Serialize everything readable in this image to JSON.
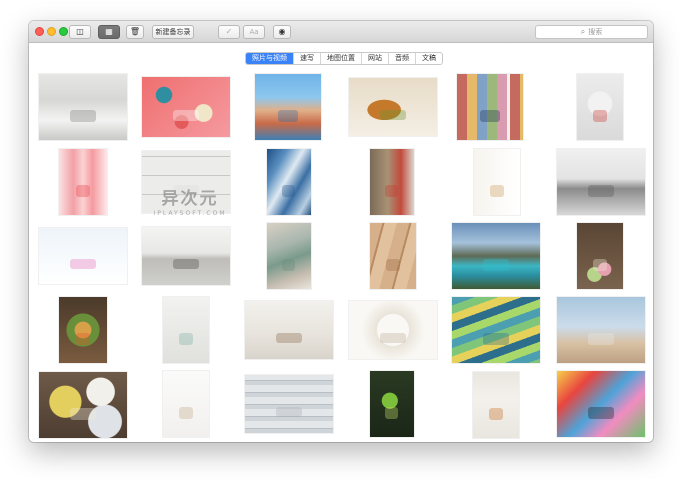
{
  "toolbar": {
    "new_note_label": "新建备忘录",
    "font_label": "Aa",
    "search_placeholder": "搜索"
  },
  "filter_tabs": [
    {
      "label": "照片与视频",
      "selected": true
    },
    {
      "label": "速写",
      "selected": false
    },
    {
      "label": "地图位置",
      "selected": false
    },
    {
      "label": "网站",
      "selected": false
    },
    {
      "label": "音频",
      "selected": false
    },
    {
      "label": "文稿",
      "selected": false
    }
  ],
  "watermark": {
    "main": "异次元",
    "sub": "IPLAYSOFT.COM"
  },
  "colors": {
    "accent": "#3a82f7",
    "close": "#fd5f57",
    "minimize": "#febc2e",
    "zoom": "#29c940"
  },
  "icons": [
    "sidebar-toggle-icon",
    "grid-view-icon",
    "trash-icon",
    "checklist-icon",
    "share-icon",
    "search-icon"
  ],
  "photos": [
    {
      "name": "white-kitchen",
      "bg": "linear-gradient(#e6e6e4 0%, #d7d7d5 40%, #f3f3f3 70%, #c9c9c7 100%)",
      "accent": "#7a7a78"
    },
    {
      "name": "macarons",
      "bg": "radial-gradient(circle at 25% 30%, #2f8fa0 0 10%, transparent 11%), radial-gradient(circle at 70% 60%, #f2e6c9 0 12%, transparent 13%), radial-gradient(circle at 45% 75%, #e35a5a 0 10%, transparent 11%), linear-gradient(135deg, #ef6f6f, #f59aa0)",
      "accent": "#ffffff"
    },
    {
      "name": "seaside-town",
      "bg": "linear-gradient(#6fb4e8 0%, #8cc6ee 35%, #e0b08a 55%, #c96b48 75%, #3f7fb4 100%)",
      "accent": "#2b6ca8"
    },
    {
      "name": "burger",
      "bg": "radial-gradient(ellipse at 40% 55%, #c47a2a 0 22%, transparent 23%), linear-gradient(#e8dcc8, #f4eee4)",
      "accent": "#6a8f2f"
    },
    {
      "name": "color-swatches",
      "bg": "repeating-linear-gradient(90deg, #c56a5e 0 10px, #e6b96a 10px 20px, #7fa2c6 20px 30px, #9cb87a 30px 40px, #d99bb0 40px 50px, #f2f0ea 50px 53px)",
      "accent": "#1f2f4f"
    },
    {
      "name": "fruit-bowl",
      "bg": "radial-gradient(circle at 50% 45%, #f2f2f2 0 28%, transparent 29%), radial-gradient(circle at 50% 45%, #d63b5b 0 18%, transparent 19%), linear-gradient(#ececec, #dadada)",
      "accent": "#c33"
    },
    {
      "name": "lemonade-drinks",
      "bg": "linear-gradient(90deg, #fbe1e1 0%, #f2a0a6 30%, #fbd2d2 50%, #f59aa0 70%, #fde9ea 100%)",
      "accent": "#e8434b"
    },
    {
      "name": "white-tiles",
      "bg": "repeating-linear-gradient(0deg, #ececea 0 18px, #c8c8c6 18px 19px), repeating-linear-gradient(90deg, transparent 0 22px, #c8c8c6 22px 23px)",
      "accent": "#dcdcda"
    },
    {
      "name": "blue-fabric",
      "bg": "linear-gradient(120deg, #1f4f86 0%, #5a8fc0 25%, #dfeaf2 45%, #3b6fa4 65%, #b7cfe2 85%, #254f7e 100%)",
      "accent": "#2a5b8f"
    },
    {
      "name": "kitchen-utensils",
      "bg": "linear-gradient(90deg, #7a6a58 0%, #a89274 40%, #c24a3c 70%, #dcd6cc 100%)",
      "accent": "#c83a30"
    },
    {
      "name": "wooden-spoons",
      "bg": "linear-gradient(90deg, #f7f4ee, #ffffff)",
      "accent": "#c89a5a"
    },
    {
      "name": "kitchen-counter",
      "bg": "linear-gradient(#f0f0f0 0%, #e3e3e3 45%, #8b8b8b 60%, #d8d8d8 100%)",
      "accent": "#555"
    },
    {
      "name": "paper-bunting",
      "bg": "linear-gradient(#eef4fa, #ffffff)",
      "accent": "#e46fb8"
    },
    {
      "name": "kitchen-cabinets",
      "bg": "linear-gradient(#f4f4f2 0%, #e7e7e5 45%, #bfbdb8 55%, #cfd0cc 100%)",
      "accent": "#444"
    },
    {
      "name": "fabric-swatches",
      "bg": "linear-gradient(160deg, #d8d0c4 0%, #a8b6ae 35%, #7a9a8c 55%, #c9bfb2 80%, #eae6df 100%)",
      "accent": "#6b8b7c"
    },
    {
      "name": "wood-planks",
      "bg": "repeating-linear-gradient(105deg, #d6b08a 0 12px, #b88a62 12px 14px, #e2c29e 14px 26px)",
      "accent": "#9a6c44"
    },
    {
      "name": "mountain-lake",
      "bg": "linear-gradient(#6a8fb8 0%, #a5c2dc 30%, #5e6a55 50%, #3bb6c4 65%, #2a8ea0 80%, #3f5a33 100%)",
      "accent": "#2ec0cf"
    },
    {
      "name": "coffee-macarons",
      "bg": "radial-gradient(circle at 60% 70%, #e6a0b0 0 12%, transparent 13%), radial-gradient(circle at 38% 78%, #b8d48a 0 12%, transparent 13%), linear-gradient(#5a4634, #7a634e)",
      "accent": "#f4e9d6"
    },
    {
      "name": "salad-platter",
      "bg": "radial-gradient(circle at 50% 50%, #d9a04a 0 20%, transparent 21%), radial-gradient(circle at 50% 50%, #6a8f3a 0 40%, transparent 41%), linear-gradient(#4b3a2a, #7a5b3f)",
      "accent": "#e2562f"
    },
    {
      "name": "window-view",
      "bg": "linear-gradient(#f2f2f0, #e0e0dd)",
      "accent": "#7ab0a0"
    },
    {
      "name": "wooden-spoons-jug",
      "bg": "linear-gradient(#f3f1ed 0%, #e7e3dc 60%, #d9d4cb 100%)",
      "accent": "#8a6a4a"
    },
    {
      "name": "white-lace",
      "bg": "radial-gradient(circle, #faf8f4 30%, #e9e4da 31%, #faf8f4 60%), linear-gradient(#efe9df, #d8cfc2)",
      "accent": "#b9ab96"
    },
    {
      "name": "colored-pencils",
      "bg": "repeating-linear-gradient(160deg, #4c9fb0 0 8px, #7fc57a 8px 16px, #e6d25a 16px 24px, #2c6e8c 24px 32px, #a8d86a 32px 40px)",
      "accent": "#2c6e8c"
    },
    {
      "name": "camper-trailer",
      "bg": "linear-gradient(#a9c6dc 0%, #cbdceb 45%, #d8c1a4 70%, #bda084 100%)",
      "accent": "#e9e9e9"
    },
    {
      "name": "yarn-balls",
      "bg": "radial-gradient(circle at 30% 45%, #e2cf5e 0 22%, transparent 23%), radial-gradient(circle at 70% 30%, #f1f0ea 0 18%, transparent 19%), radial-gradient(circle at 75% 75%, #dfe3e8 0 20%, transparent 21%), linear-gradient(#6f5a48, #4d3d31)",
      "accent": "#f0e9d8"
    },
    {
      "name": "gift-tags",
      "bg": "linear-gradient(#fbfbfa, #f1f0ee)",
      "accent": "#c2a88a"
    },
    {
      "name": "white-wood",
      "bg": "repeating-linear-gradient(0deg, #cfd4d8 0 4px, #b8bec3 4px 5px, #e4e7ea 5px 12px)",
      "accent": "#aab0b5"
    },
    {
      "name": "green-smoothie",
      "bg": "radial-gradient(circle at 45% 45%, #7bbf3a 0 18%, transparent 19%), linear-gradient(#2a3a22, #1b2618)",
      "accent": "#c9e36a"
    },
    {
      "name": "honey-bottle",
      "bg": "linear-gradient(#e9e6e0 0%, #f4f1ec 40%, #e9e6e0 100%)",
      "accent": "#c66a1f"
    },
    {
      "name": "colorful-illustration",
      "bg": "linear-gradient(135deg, #f6d04a 0%, #e9453f 25%, #4ea3d8 50%, #f28cc0 70%, #6cc16a 100%)",
      "accent": "#1e1e1e"
    }
  ]
}
